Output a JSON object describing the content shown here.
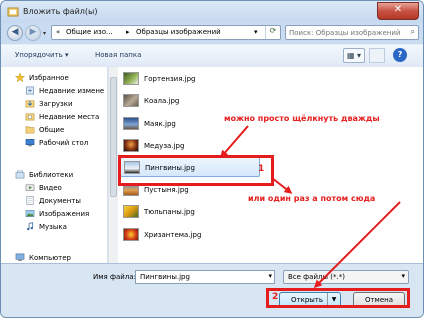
{
  "window": {
    "title": "Вложить файл(ы)",
    "close_label": "✕"
  },
  "nav": {
    "back": "◀",
    "forward": "▶",
    "recent": "▾",
    "path": [
      "«",
      "Общие изо...",
      "▸",
      "Образцы изображений",
      "▾"
    ],
    "refresh": "⟳",
    "search_placeholder": "Поиск: Образцы изображений",
    "search_icon": "⌕"
  },
  "toolbar": {
    "organize": "Упорядочить ▾",
    "new_folder": "Новая папка",
    "view_icon": "▦ ▾",
    "help_icon": "?"
  },
  "sidebar": {
    "items": [
      {
        "label": "Избранное",
        "icon": "star-icon"
      },
      {
        "label": "Недавние измене",
        "icon": "recent-changes-icon"
      },
      {
        "label": "Загрузки",
        "icon": "downloads-icon"
      },
      {
        "label": "Недавние места",
        "icon": "recent-places-icon"
      },
      {
        "label": "Общие",
        "icon": "folder-icon"
      },
      {
        "label": "Рабочий стол",
        "icon": "desktop-icon"
      },
      {
        "label": "Библиотеки",
        "icon": "libraries-icon"
      },
      {
        "label": "Видео",
        "icon": "video-icon"
      },
      {
        "label": "Документы",
        "icon": "documents-icon"
      },
      {
        "label": "Изображения",
        "icon": "images-icon"
      },
      {
        "label": "Музыка",
        "icon": "music-icon"
      },
      {
        "label": "Компьютер",
        "icon": "computer-icon"
      }
    ]
  },
  "files": [
    {
      "name": "Гортензия.jpg",
      "color": "#6f8f3c"
    },
    {
      "name": "Коала.jpg",
      "color": "#8a7d6a"
    },
    {
      "name": "Маяк.jpg",
      "color": "#3b6da8"
    },
    {
      "name": "Медуза.jpg",
      "color": "#c06a2a"
    },
    {
      "name": "Пингвины.jpg",
      "color": "#5c7fa8"
    },
    {
      "name": "Пустыня.jpg",
      "color": "#c8832f"
    },
    {
      "name": "Тюльпаны.jpg",
      "color": "#d9a21c"
    },
    {
      "name": "Хризантема.jpg",
      "color": "#c93a1a"
    }
  ],
  "annotations": {
    "double_click": "можно просто щёлкнуть дважды",
    "marker1": "1",
    "or_once": "или один раз а потом сюда",
    "marker2": "2"
  },
  "bottom": {
    "filename_label": "Имя файла:",
    "filename_value": "Пингвины.jpg",
    "filter_value": "Все файлы (*.*)",
    "open_label": "Открыть",
    "cancel_label": "Отмена"
  },
  "colors": {
    "annotation_red": "#e51d1d",
    "selection_blue": "#84acdd",
    "chrome_blue": "#c9dcf1"
  }
}
